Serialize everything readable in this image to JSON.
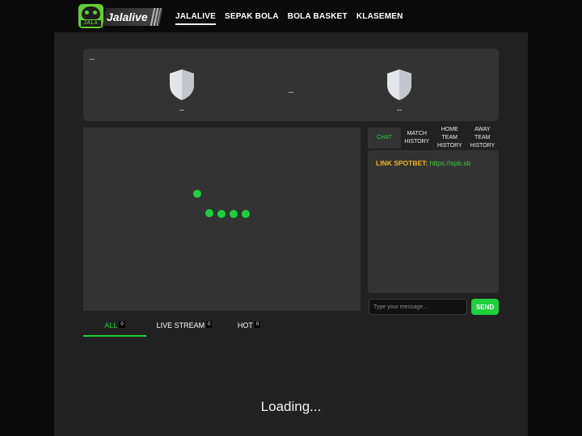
{
  "brand": {
    "logo_text": "Jalalive",
    "badge_text": "JALA"
  },
  "nav": {
    "items": [
      {
        "label": "JALALIVE",
        "active": true
      },
      {
        "label": "SEPAK BOLA",
        "active": false
      },
      {
        "label": "BOLA BASKET",
        "active": false
      },
      {
        "label": "KLASEMEN",
        "active": false
      }
    ]
  },
  "match": {
    "status": "--",
    "score": "--",
    "home": {
      "name": "--",
      "icon": "shield-icon"
    },
    "away": {
      "name": "--",
      "icon": "shield-icon"
    }
  },
  "player": {
    "loading_indicator": "dots-spinner",
    "dot_color": "#1dd13d"
  },
  "side_tabs": [
    {
      "label": "CHAT",
      "active": true
    },
    {
      "label": "MATCH\nHISTORY",
      "active": false
    },
    {
      "label": "HOME TEAM\nHISTORY",
      "active": false
    },
    {
      "label": "AWAY TEAM\nHISTORY",
      "active": false
    }
  ],
  "chat": {
    "pinned_label": "LINK SPOTBET:",
    "pinned_link": "https://spb.sb",
    "input_placeholder": "Type your message...",
    "send_label": "SEND"
  },
  "filters": [
    {
      "label": "ALL",
      "count": "0",
      "active": true
    },
    {
      "label": "LIVE STREAM",
      "count": "0",
      "active": false
    },
    {
      "label": "HOT",
      "count": "0",
      "active": false
    }
  ],
  "list": {
    "loading_text": "Loading..."
  },
  "colors": {
    "accent": "#1dd13d",
    "logo_green": "#5fd12f",
    "highlight": "#f2b21b",
    "panel": "#333333",
    "container": "#212121",
    "background": "#0b0a0b"
  }
}
